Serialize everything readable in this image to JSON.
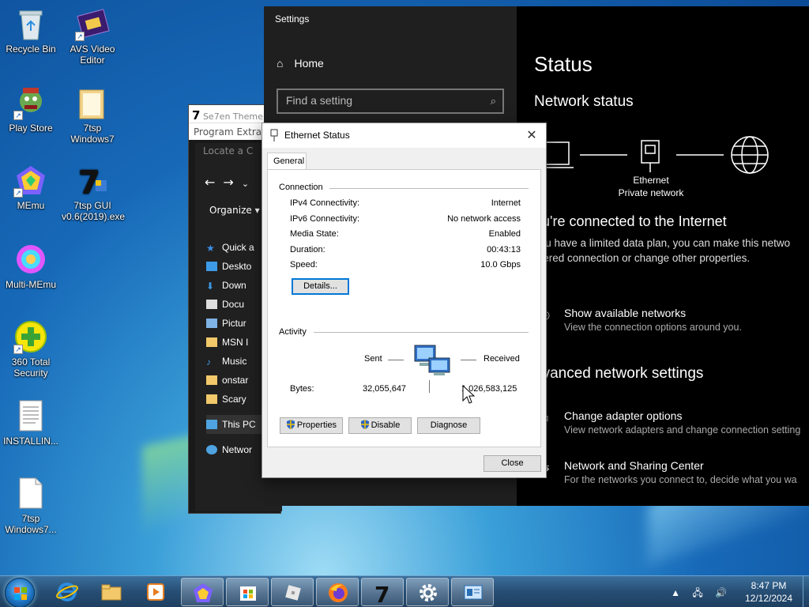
{
  "desktop": {
    "icons": [
      {
        "label": "Recycle Bin"
      },
      {
        "label": "AVS Video Editor"
      },
      {
        "label": "Play Store"
      },
      {
        "label": "7tsp Windows7"
      },
      {
        "label": "MEmu"
      },
      {
        "label": "7tsp GUI v0.6(2019).exe"
      },
      {
        "label": "Multi-MEmu"
      },
      {
        "label": "360 Total Security"
      },
      {
        "label": "INSTALLIN..."
      },
      {
        "label": "7tsp Windows7..."
      }
    ]
  },
  "explorer": {
    "title": "Se7en Theme",
    "menu": "Program   Extra",
    "locate": "Locate a C",
    "organize": "Organize ▾",
    "nav": [
      "Quick a",
      "Deskto",
      "Down",
      "Docu",
      "Pictur",
      "MSN I",
      "Music",
      "onstar",
      "Scary",
      "This PC",
      "Networ"
    ]
  },
  "settings": {
    "window_title": "Settings",
    "home": "Home",
    "search_placeholder": "Find a setting",
    "heading": "Status",
    "subheading": "Network status",
    "ethernet": "Ethernet",
    "private_network": "Private network",
    "connected": "ou're connected to the Internet",
    "limited_line1": "you have a limited data plan, you can make this netwo",
    "limited_line2": "etered connection or change other properties.",
    "show_networks": "Show available networks",
    "show_networks_sub": "View the connection options around you.",
    "advanced": "dvanced network settings",
    "change_adapter": "Change adapter options",
    "change_adapter_sub": "View network adapters and change connection setting",
    "sharing_center": "Network and Sharing Center",
    "sharing_center_sub": "For the networks you connect to, decide what you wa"
  },
  "dialog": {
    "title": "Ethernet Status",
    "tab": "General",
    "connection_label": "Connection",
    "rows": [
      {
        "k": "IPv4 Connectivity:",
        "v": "Internet"
      },
      {
        "k": "IPv6 Connectivity:",
        "v": "No network access"
      },
      {
        "k": "Media State:",
        "v": "Enabled"
      },
      {
        "k": "Duration:",
        "v": "00:43:13"
      },
      {
        "k": "Speed:",
        "v": "10.0 Gbps"
      }
    ],
    "details": "Details...",
    "activity_label": "Activity",
    "sent": "Sent",
    "received": "Received",
    "bytes_label": "Bytes:",
    "bytes_sent": "32,055,647",
    "bytes_received": "1,026,583,125",
    "properties": "Properties",
    "disable": "Disable",
    "diagnose": "Diagnose",
    "close": "Close"
  },
  "taskbar": {
    "time": "8:47 PM",
    "date": "12/12/2024",
    "tray_icons": "▲ 🖧 🔊"
  },
  "colors": {
    "accent": "#0078d7",
    "settings_left": "#1f1f1f",
    "settings_right": "#000000"
  }
}
